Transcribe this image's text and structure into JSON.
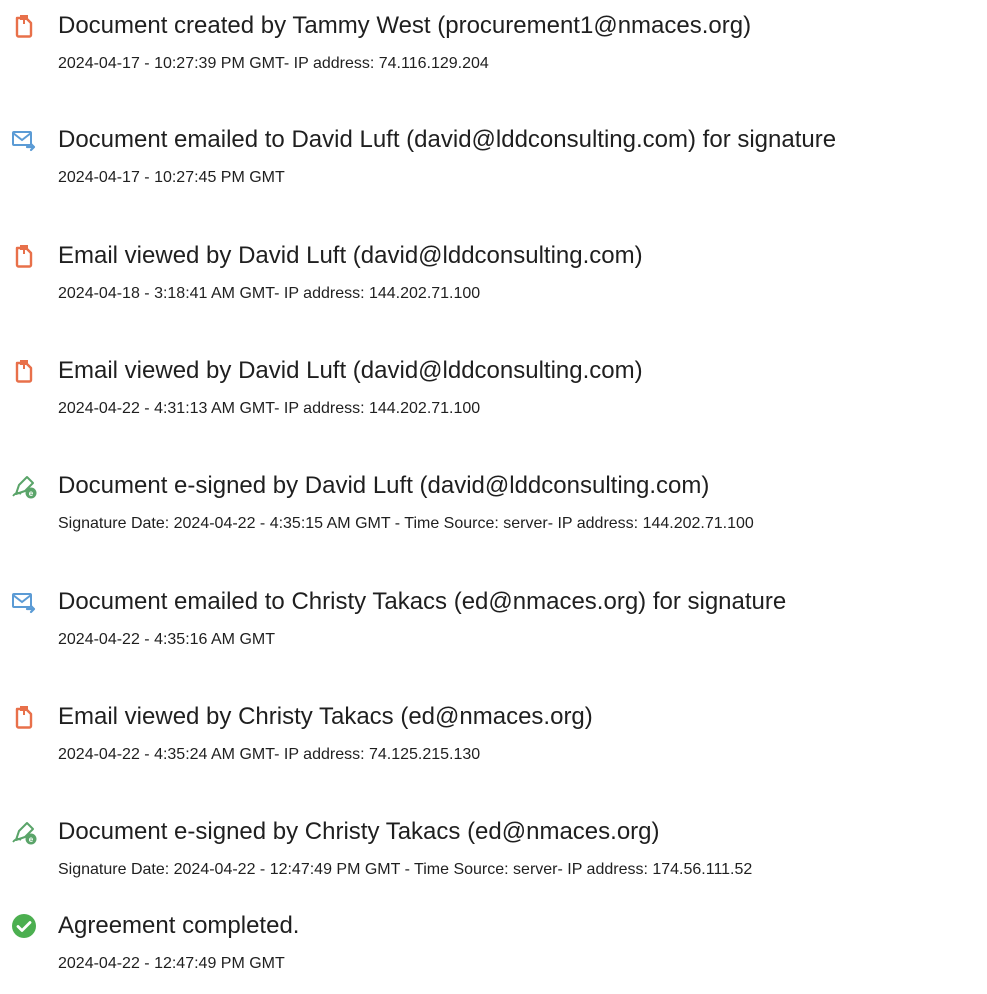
{
  "colors": {
    "doc_icon": "#e8704a",
    "mail_icon": "#5b9bd5",
    "sign_icon": "#5aa469",
    "complete_icon": "#4caf50"
  },
  "events": [
    {
      "icon": "document-icon",
      "headline": "Document created by Tammy West (procurement1@nmaces.org)",
      "detail": "2024-04-17 - 10:27:39 PM GMT- IP address: 74.116.129.204"
    },
    {
      "icon": "email-icon",
      "headline": "Document emailed to David Luft (david@lddconsulting.com) for signature",
      "detail": "2024-04-17 - 10:27:45 PM GMT"
    },
    {
      "icon": "document-icon",
      "headline": "Email viewed by David Luft (david@lddconsulting.com)",
      "detail": "2024-04-18 - 3:18:41 AM GMT- IP address: 144.202.71.100"
    },
    {
      "icon": "document-icon",
      "headline": "Email viewed by David Luft (david@lddconsulting.com)",
      "detail": "2024-04-22 - 4:31:13 AM GMT- IP address: 144.202.71.100"
    },
    {
      "icon": "signature-pen-icon",
      "headline": "Document e-signed by David Luft (david@lddconsulting.com)",
      "detail": "Signature Date: 2024-04-22 - 4:35:15 AM GMT - Time Source: server- IP address: 144.202.71.100"
    },
    {
      "icon": "email-icon",
      "headline": "Document emailed to Christy Takacs (ed@nmaces.org) for signature",
      "detail": "2024-04-22 - 4:35:16 AM GMT"
    },
    {
      "icon": "document-icon",
      "headline": "Email viewed by Christy Takacs (ed@nmaces.org)",
      "detail": "2024-04-22 - 4:35:24 AM GMT- IP address: 74.125.215.130"
    },
    {
      "icon": "signature-pen-icon",
      "headline": "Document e-signed by Christy Takacs (ed@nmaces.org)",
      "detail": "Signature Date: 2024-04-22 - 12:47:49 PM GMT - Time Source: server- IP address: 174.56.111.52"
    },
    {
      "icon": "checkmark-circle-icon",
      "headline": "Agreement completed.",
      "detail": "2024-04-22 - 12:47:49 PM GMT"
    }
  ]
}
